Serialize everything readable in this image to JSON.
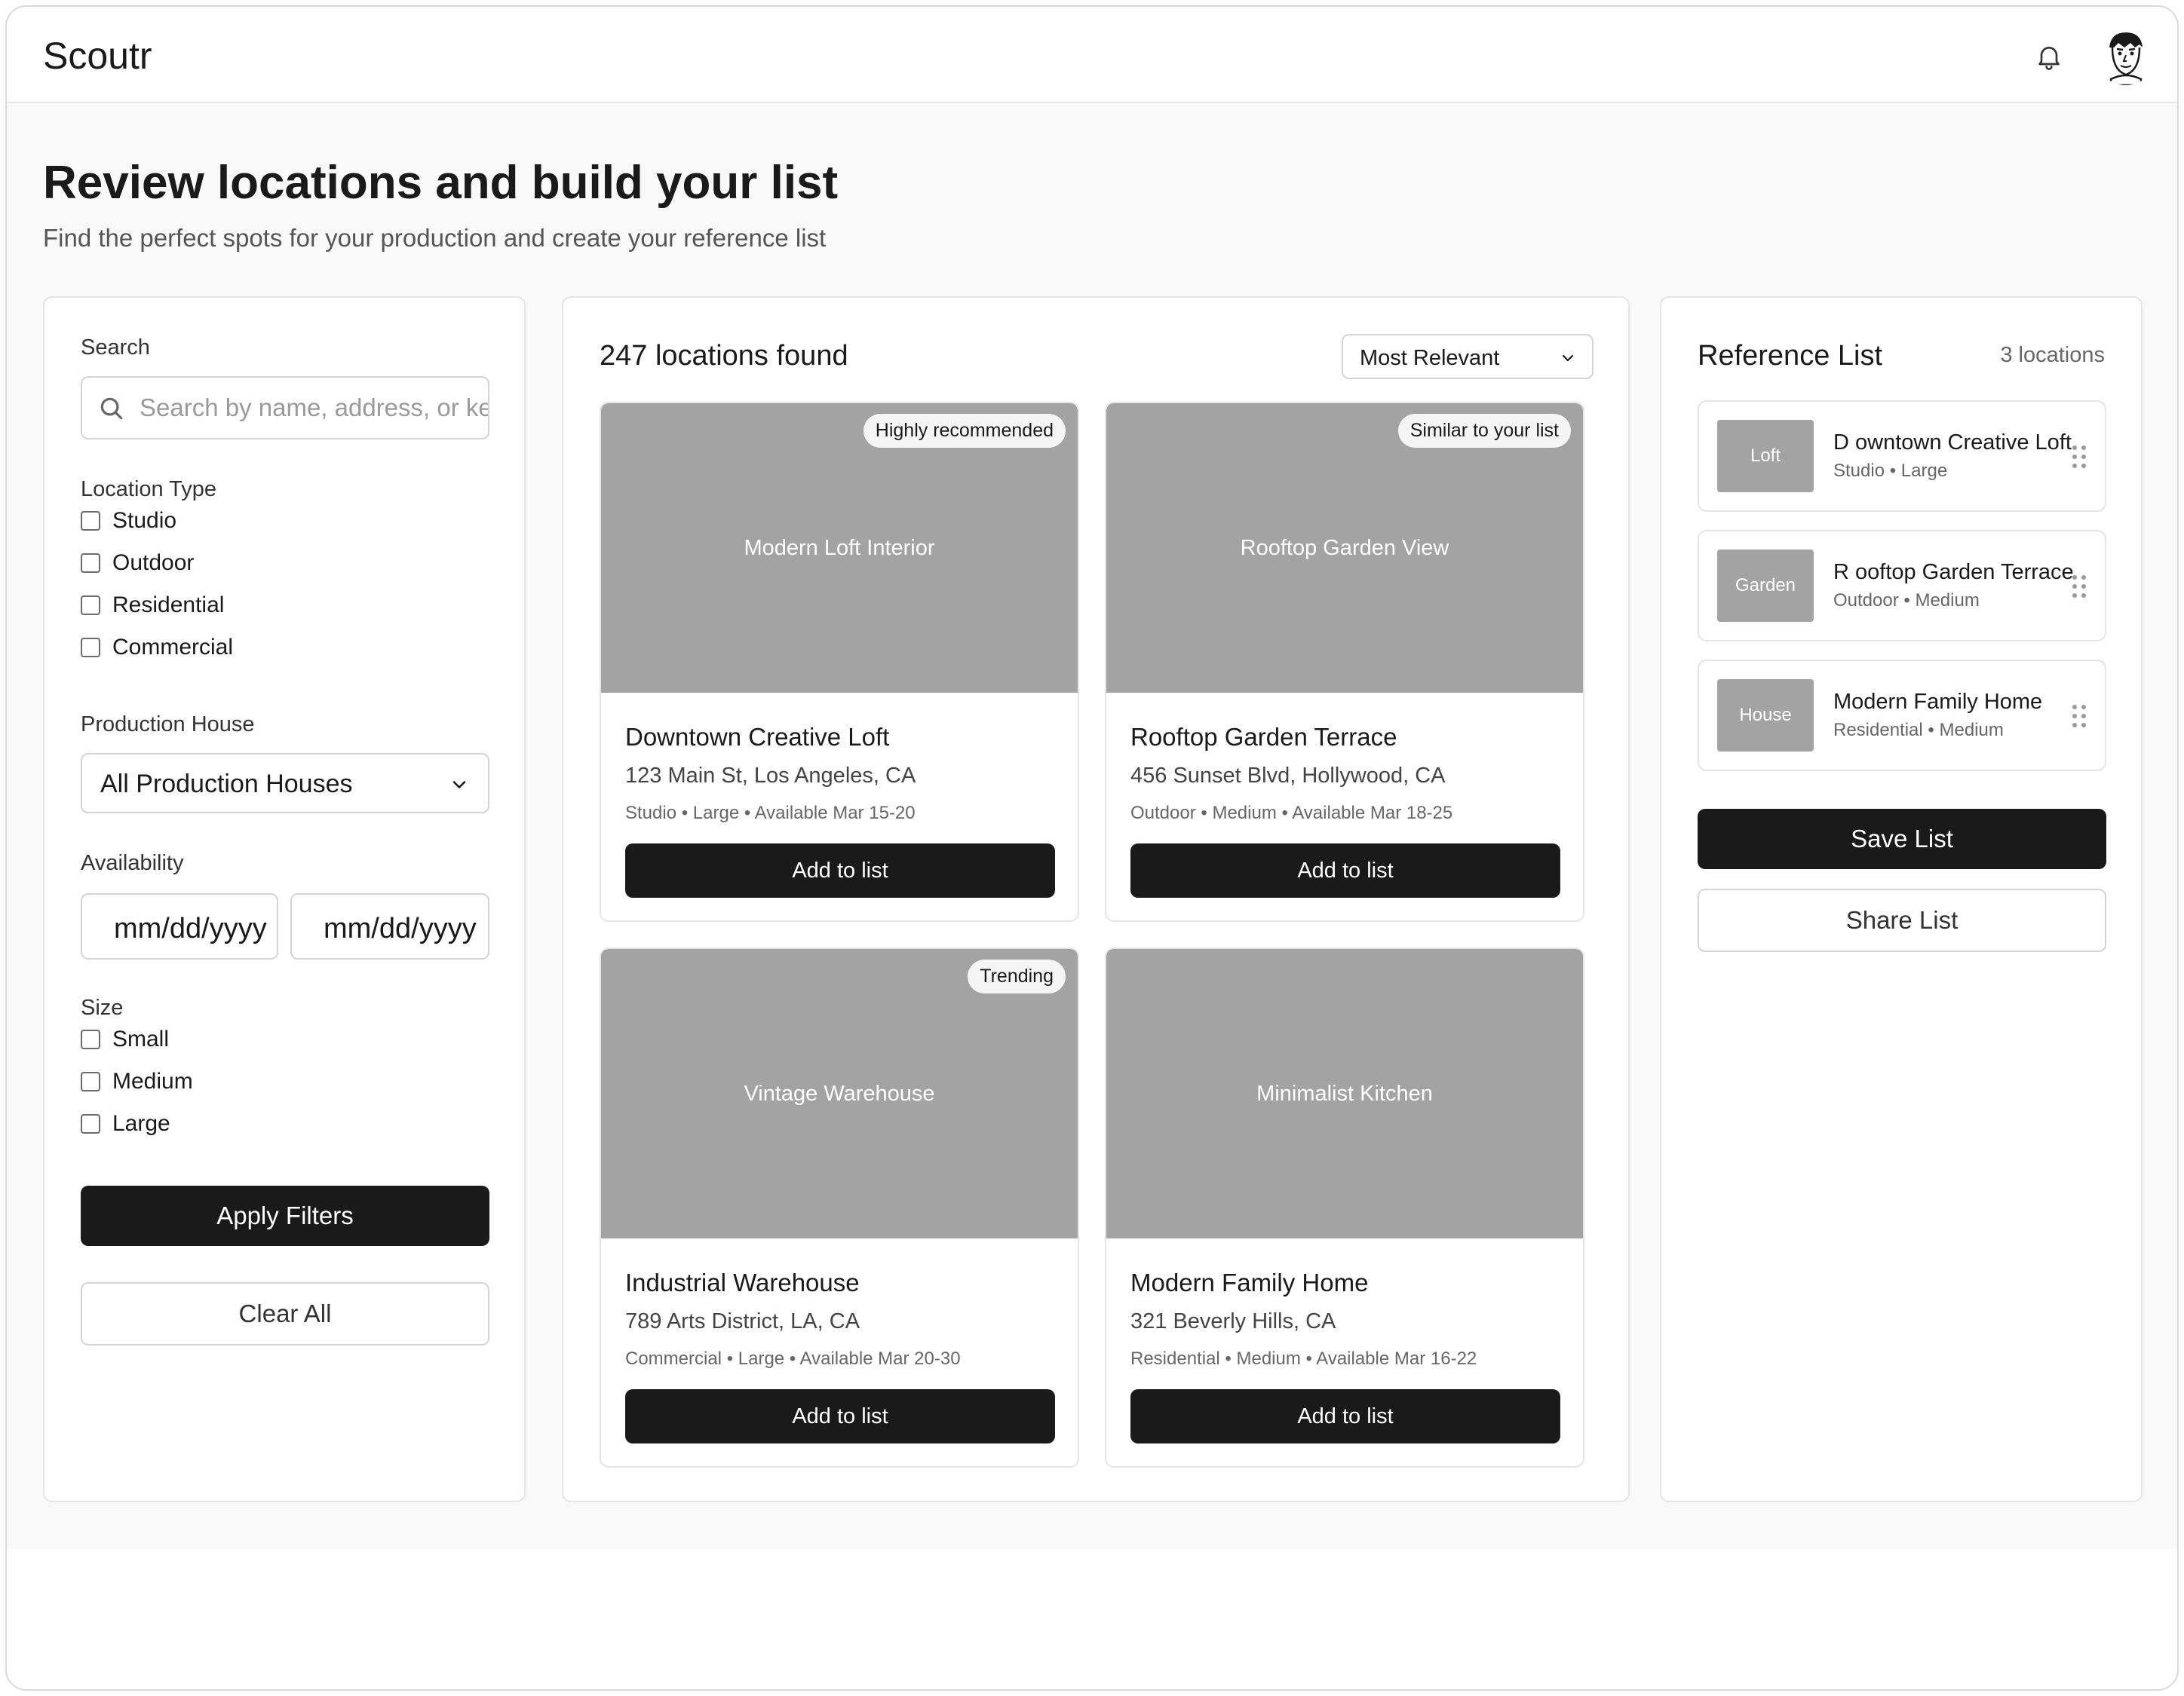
{
  "app": {
    "brand": "Scoutr",
    "icons": {
      "notifications": "bell-icon",
      "profile": "avatar"
    }
  },
  "page": {
    "title": "Review locations and build your list",
    "subtitle": "Find the perfect spots for your production and create your reference list"
  },
  "filters": {
    "search_label": "Search",
    "search_placeholder": "Search by name, address, or keywords",
    "location_type_label": "Location Type",
    "location_types": [
      "Studio",
      "Outdoor",
      "Residential",
      "Commercial"
    ],
    "production_house_label": "Production House",
    "production_house_selected": "All Production Houses",
    "availability_label": "Availability",
    "date_start_placeholder": "mm/dd/yyyy",
    "date_end_placeholder": "mm/dd/yyyy",
    "size_label": "Size",
    "sizes": [
      "Small",
      "Medium",
      "Large"
    ],
    "apply_label": "Apply Filters",
    "clear_label": "Clear All"
  },
  "results": {
    "count_text": "247 locations found",
    "sort_selected": "Most Relevant",
    "cards": [
      {
        "image_label": "Modern Loft Interior",
        "badge": "Highly recommended",
        "title": "Downtown Creative Loft",
        "address": "123 Main St, Los Angeles, CA",
        "meta": "Studio • Large • Available Mar 15-20",
        "button": "Add to list"
      },
      {
        "image_label": "Rooftop Garden View",
        "badge": "Similar to your list",
        "title": "Rooftop Garden Terrace",
        "address": "456 Sunset Blvd, Hollywood, CA",
        "meta": "Outdoor • Medium • Available Mar 18-25",
        "button": "Add to list"
      },
      {
        "image_label": "Vintage Warehouse",
        "badge": "Trending",
        "title": "Industrial Warehouse",
        "address": "789 Arts District, LA, CA",
        "meta": "Commercial • Large • Available Mar 20-30",
        "button": "Add to list"
      },
      {
        "image_label": "Minimalist Kitchen",
        "badge": "",
        "title": "Modern Family Home",
        "address": "321 Beverly Hills, CA",
        "meta": "Residential • Medium • Available Mar 16-22",
        "button": "Add to list"
      }
    ]
  },
  "reference_list": {
    "title": "Reference List",
    "count": "3 locations",
    "items": [
      {
        "thumb": "Loft",
        "name": "D owntown Creative Loft",
        "meta": "Studio • Large"
      },
      {
        "thumb": "Garden",
        "name": "R ooftop Garden Terrace",
        "meta": "Outdoor • Medium"
      },
      {
        "thumb": "House",
        "name": "Modern Family Home",
        "meta": "Residential • Medium"
      }
    ],
    "save_label": "Save List",
    "share_label": "Share List"
  },
  "colors": {
    "primary_button": "#1a1a1a",
    "image_placeholder": "#a3a3a3",
    "page_background": "#f9f9f9"
  }
}
